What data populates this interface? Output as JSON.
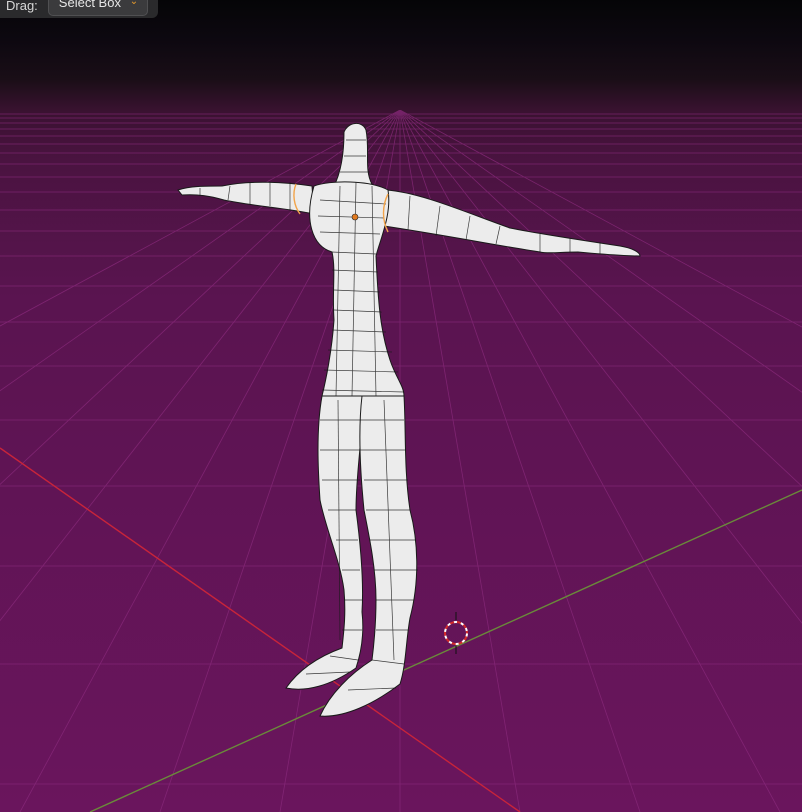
{
  "toolbar": {
    "drag_label": "Drag:",
    "drag_mode": "Select Box"
  },
  "icons": {
    "dropdown": "chevron-down-icon",
    "cursor": "3d-cursor-icon"
  },
  "colors": {
    "grid_floor": "#6a155d",
    "grid_line": "#8a2a7c",
    "x_axis": "#c8243a",
    "y_axis": "#6a8a3a",
    "mesh_fill": "#ececec",
    "mesh_wire": "#1a1a1a",
    "selection_edge": "#f2a44a",
    "object_origin": "#e07a20"
  }
}
